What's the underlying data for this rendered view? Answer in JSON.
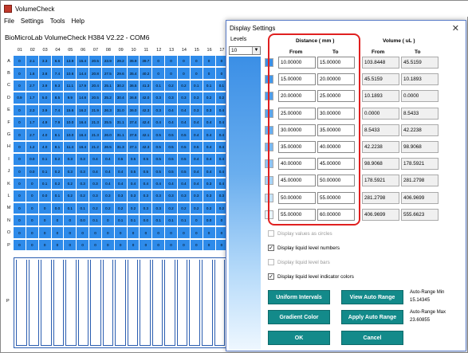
{
  "app": {
    "title": "VolumeCheck",
    "menu": [
      "File",
      "Settings",
      "Tools",
      "Help"
    ],
    "device": "BioMicroLab VolumeCheck H384 V2.22 - COM6"
  },
  "plate": {
    "columns": [
      "01",
      "02",
      "03",
      "04",
      "05",
      "06",
      "07",
      "08",
      "09",
      "10",
      "11",
      "12",
      "13",
      "14",
      "15",
      "16",
      "17"
    ],
    "rows": [
      {
        "label": "A",
        "values": [
          "0",
          "2.1",
          "3.3",
          "6.6",
          "13.9",
          "15.4",
          "20.5",
          "23.9",
          "29.2",
          "35.9",
          "39.7",
          "0",
          "0",
          "0",
          "0",
          "0",
          "0"
        ]
      },
      {
        "label": "B",
        "values": [
          "0",
          "1.6",
          "3.8",
          "7.4",
          "10.6",
          "14.4",
          "20.8",
          "27.5",
          "29.6",
          "35.4",
          "40.2",
          "0",
          "0",
          "0",
          "0",
          "0",
          "0"
        ]
      },
      {
        "label": "C",
        "values": [
          "0",
          "2.7",
          "3.9",
          "9.3",
          "11.1",
          "17.9",
          "20.4",
          "25.1",
          "30.2",
          "36.5",
          "41.3",
          "0.1",
          "0.2",
          "0.2",
          "0.1",
          "0.1",
          "0.1"
        ]
      },
      {
        "label": "D",
        "values": [
          "0.9",
          "1.7",
          "5.0",
          "8.5",
          "9.9",
          "14.8",
          "20.5",
          "25.2",
          "30.4",
          "36.8",
          "42.0",
          "0.3",
          "0.3",
          "0.3",
          "0.3",
          "0.2",
          "0.2"
        ]
      },
      {
        "label": "E",
        "values": [
          "0",
          "2.3",
          "3.9",
          "7.4",
          "15.6",
          "16.2",
          "21.9",
          "26.3",
          "31.0",
          "36.0",
          "42.3",
          "0.3",
          "0.4",
          "0.4",
          "0.3",
          "0.3",
          "0.4"
        ]
      },
      {
        "label": "F",
        "values": [
          "0",
          "1.7",
          "4.9",
          "7.9",
          "10.0",
          "16.4",
          "21.3",
          "25.5",
          "31.1",
          "37.4",
          "42.4",
          "0.4",
          "0.4",
          "0.4",
          "0.4",
          "0.4",
          "0.4"
        ]
      },
      {
        "label": "G",
        "values": [
          "0",
          "2.7",
          "4.0",
          "8.1",
          "10.0",
          "16.4",
          "21.3",
          "26.0",
          "31.1",
          "37.6",
          "42.1",
          "0.5",
          "0.5",
          "0.5",
          "0.4",
          "0.4",
          "0.4"
        ]
      },
      {
        "label": "H",
        "values": [
          "0",
          "1.2",
          "4.0",
          "8.1",
          "11.4",
          "16.4",
          "21.2",
          "26.5",
          "31.3",
          "37.1",
          "42.3",
          "0.5",
          "0.5",
          "0.5",
          "0.5",
          "0.4",
          "0.4"
        ]
      },
      {
        "label": "I",
        "values": [
          "0",
          "0.0",
          "0.1",
          "0.2",
          "0.3",
          "0.3",
          "0.4",
          "0.4",
          "0.5",
          "0.5",
          "0.5",
          "0.5",
          "0.5",
          "0.5",
          "0.4",
          "0.4",
          "0.4"
        ]
      },
      {
        "label": "J",
        "values": [
          "0",
          "0.0",
          "0.1",
          "0.2",
          "0.3",
          "0.3",
          "0.4",
          "0.4",
          "0.4",
          "0.5",
          "0.5",
          "0.5",
          "0.5",
          "0.5",
          "0.4",
          "0.4",
          "0.4"
        ]
      },
      {
        "label": "K",
        "values": [
          "0",
          "0",
          "0.1",
          "0.2",
          "0.2",
          "0.3",
          "0.3",
          "0.4",
          "0.4",
          "0.4",
          "0.4",
          "0.4",
          "0.4",
          "0.4",
          "0.4",
          "0.3",
          "0.4"
        ]
      },
      {
        "label": "L",
        "values": [
          "0",
          "0",
          "0.0",
          "0.1",
          "0.2",
          "0.2",
          "0.3",
          "0.3",
          "0.3",
          "0.3",
          "0.3",
          "0.3",
          "0.3",
          "0.3",
          "0.3",
          "0.3",
          "0.3"
        ]
      },
      {
        "label": "M",
        "values": [
          "0",
          "0",
          "0",
          "0.0",
          "0.1",
          "0.1",
          "0.2",
          "0.2",
          "0.2",
          "0.2",
          "0.3",
          "0.3",
          "0.2",
          "0.2",
          "0.2",
          "0.2",
          "0.2"
        ]
      },
      {
        "label": "N",
        "values": [
          "0",
          "0",
          "0",
          "0",
          "0",
          "0.0",
          "0.1",
          "0",
          "0.1",
          "0.1",
          "0.0",
          "0.1",
          "0.1",
          "0.1",
          "0",
          "0.0",
          "0"
        ]
      },
      {
        "label": "O",
        "values": [
          "0",
          "0",
          "0",
          "0",
          "0",
          "0",
          "0",
          "0",
          "0",
          "0",
          "0",
          "0",
          "0",
          "0",
          "0",
          "0",
          "0"
        ]
      },
      {
        "label": "P",
        "values": [
          "0",
          "0",
          "0",
          "0",
          "0",
          "0",
          "0",
          "0",
          "0",
          "0",
          "0",
          "0",
          "0",
          "0",
          "0",
          "0",
          "0"
        ]
      }
    ],
    "tube_row_label": "P"
  },
  "dialog": {
    "title": "Display Settings",
    "close": "✕",
    "levels_label": "Levels",
    "levels_value": "10",
    "distance_header": "Distance ( mm )",
    "volume_header": "Volume ( uL )",
    "from_label": "From",
    "to_label": "To",
    "levels": [
      {
        "color": "#3b8fe6",
        "d_from": "10.00000",
        "d_to": "15.00000",
        "v_from": "103.8448",
        "v_to": "45.5159"
      },
      {
        "color": "#4596e8",
        "d_from": "15.00000",
        "d_to": "20.00000",
        "v_from": "45.5159",
        "v_to": "10.1893"
      },
      {
        "color": "#509de9",
        "d_from": "20.00000",
        "d_to": "25.00000",
        "v_from": "10.1893",
        "v_to": "0.0000"
      },
      {
        "color": "#5ca5eb",
        "d_from": "25.00000",
        "d_to": "30.00000",
        "v_from": "0.0000",
        "v_to": "8.5433"
      },
      {
        "color": "#6aadee",
        "d_from": "30.00000",
        "d_to": "35.00000",
        "v_from": "8.5433",
        "v_to": "42.2238"
      },
      {
        "color": "#7bb7f0",
        "d_from": "35.00000",
        "d_to": "40.00000",
        "v_from": "42.2238",
        "v_to": "98.9068"
      },
      {
        "color": "#8fc3f3",
        "d_from": "40.00000",
        "d_to": "45.00000",
        "v_from": "98.9068",
        "v_to": "178.5921"
      },
      {
        "color": "#a9d2f6",
        "d_from": "45.00000",
        "d_to": "50.00000",
        "v_from": "178.5921",
        "v_to": "281.2798"
      },
      {
        "color": "#c8e2f9",
        "d_from": "50.00000",
        "d_to": "55.00000",
        "v_from": "281.2798",
        "v_to": "406.9699"
      },
      {
        "color": "#eaf4fd",
        "d_from": "55.00000",
        "d_to": "60.00000",
        "v_from": "406.9699",
        "v_to": "555.6623"
      }
    ],
    "checkboxes": [
      {
        "label": "Display values as circles",
        "checked": false,
        "enabled": false
      },
      {
        "label": "Display liquid level numbers",
        "checked": true,
        "enabled": true
      },
      {
        "label": "Display liquid level bars",
        "checked": false,
        "enabled": false
      },
      {
        "label": "Display liquid level indicator colors",
        "checked": true,
        "enabled": true
      }
    ],
    "buttons": {
      "uniform": "Uniform Intervals",
      "view_auto": "View Auto Range",
      "gradient": "Gradient Color",
      "apply_auto": "Apply Auto Range",
      "ok": "OK",
      "cancel": "Cancel"
    },
    "auto_range_min_label": "Auto-Range Min",
    "auto_range_min_value": "15.14345",
    "auto_range_max_label": "Auto-Range Max",
    "auto_range_max_value": "23.60855",
    "highlight_color": "#e02020",
    "button_color": "#138a8a"
  }
}
